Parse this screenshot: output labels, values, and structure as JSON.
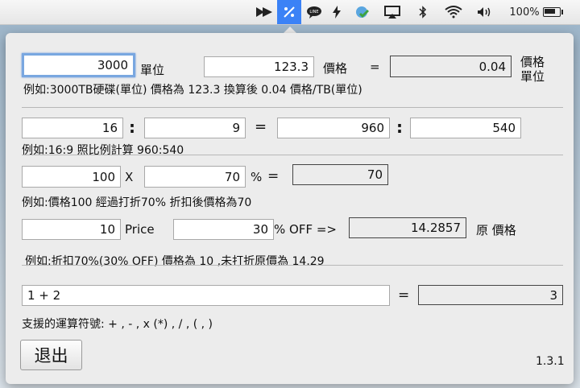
{
  "menubar": {
    "icons": [
      "arrow-icon",
      "calculator-icon",
      "line-icon",
      "bolt-icon",
      "sync-icon",
      "airplay-icon",
      "bluetooth-icon",
      "wifi-icon",
      "volume-icon"
    ],
    "battery_text": "100%"
  },
  "unit_calc": {
    "amount_value": "3000",
    "unit_label": "單位",
    "price_value": "123.3",
    "price_label": "價格",
    "equals": "=",
    "result_value": "0.04",
    "result_label_line1": "價格",
    "result_label_line2": "單位",
    "example": "例如:3000TB硬碟(單位) 價格為 123.3 換算後 0.04 價格/TB(單位)"
  },
  "ratio_calc": {
    "a": "16",
    "colon1": ":",
    "b": "9",
    "equals": "=",
    "c": "960",
    "colon2": ":",
    "d": "540",
    "example": "例如:16:9 照比例計算 960:540"
  },
  "discount_calc": {
    "price": "100",
    "times": "X",
    "percent": "70",
    "percent_sign": "%",
    "equals": "=",
    "result": "70",
    "example": "例如:價格100 經過打折70% 折扣後價格為70"
  },
  "off_calc": {
    "price": "10",
    "price_label": "Price",
    "percent": "30",
    "off_label": "% OFF =>",
    "result": "14.2857",
    "result_label": "原 價格",
    "example": "例如:折扣70%(30% OFF) 價格為 10 ,未打折原價為 14.29"
  },
  "expr_calc": {
    "expression": "1 + 2",
    "equals": "=",
    "result": "3",
    "help": "支援的運算符號: + , - , x (*) , / , ( , )"
  },
  "footer": {
    "quit_label": "退出",
    "version": "1.3.1"
  }
}
